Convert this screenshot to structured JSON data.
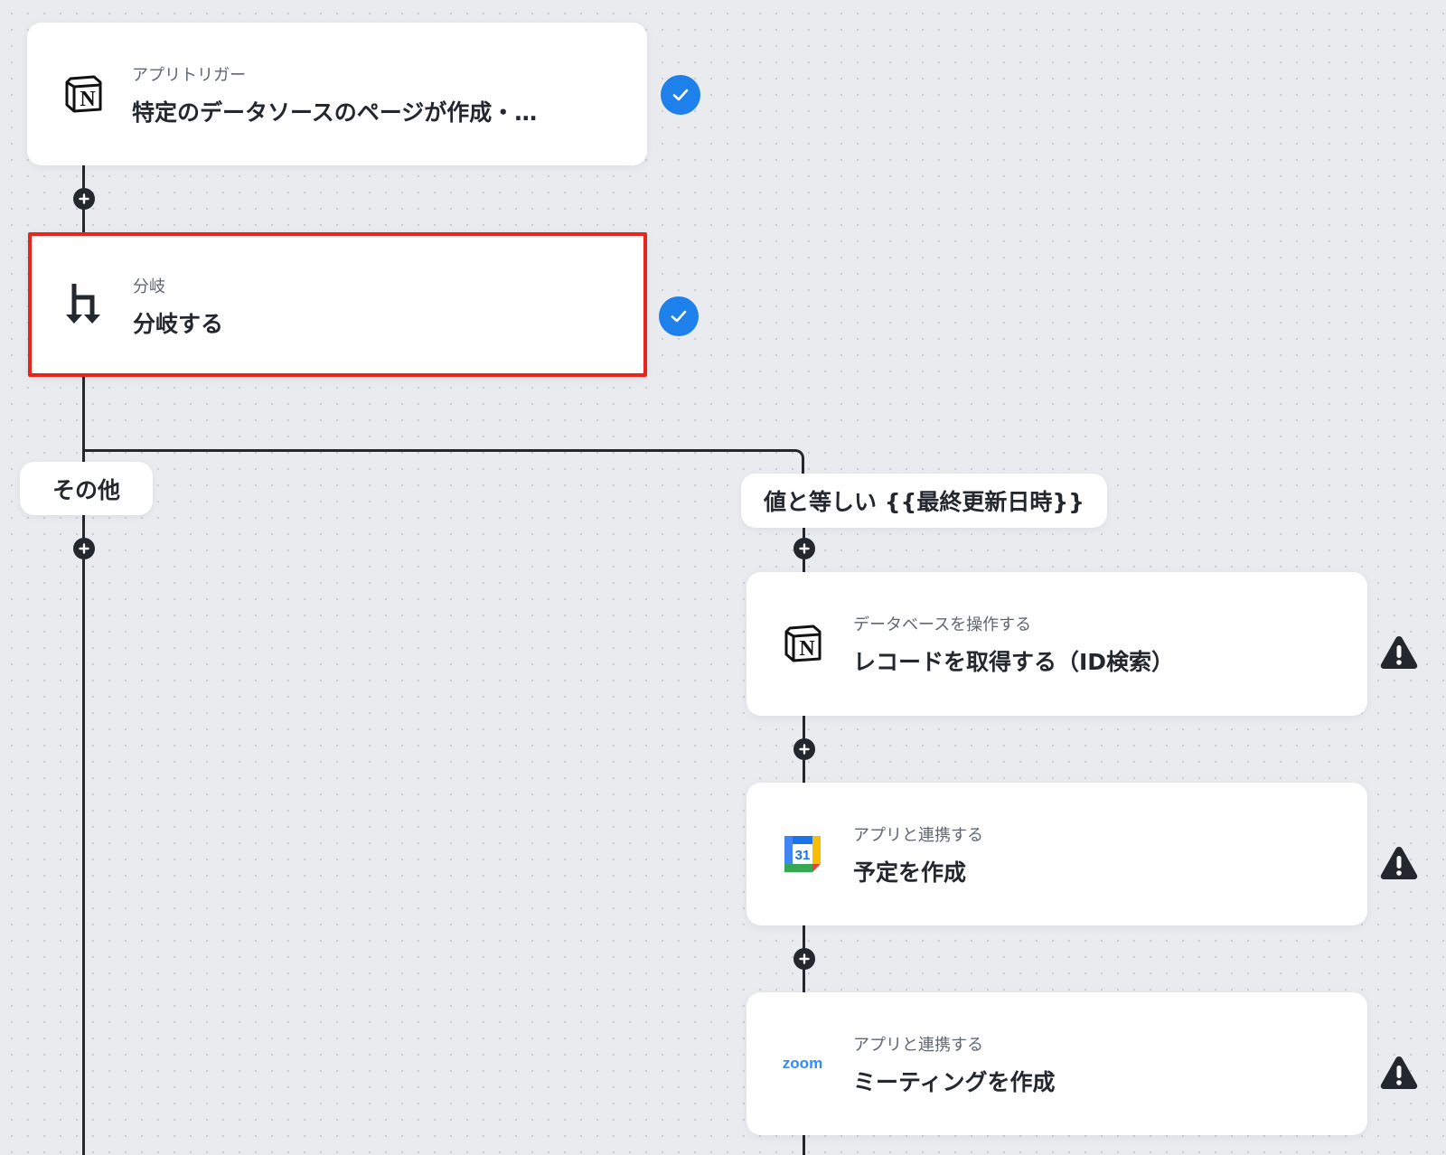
{
  "flow": {
    "trigger": {
      "subtitle": "アプリトリガー",
      "title": "特定のデータソースのページが作成・…",
      "icon": "notion-icon",
      "status": "complete"
    },
    "branch": {
      "subtitle": "分岐",
      "title": "分岐する",
      "icon": "branch-icon",
      "status": "complete",
      "selected": true
    },
    "branches": {
      "other_label": "その他",
      "condition_label": "値と等しい {{最終更新日時}}"
    },
    "steps": [
      {
        "subtitle": "データベースを操作する",
        "title": "レコードを取得する（ID検索）",
        "icon": "notion-icon",
        "status": "warning"
      },
      {
        "subtitle": "アプリと連携する",
        "title": "予定を作成",
        "icon": "google-calendar-icon",
        "icon_text": "31",
        "status": "warning"
      },
      {
        "subtitle": "アプリと連携する",
        "title": "ミーティングを作成",
        "icon": "zoom-icon",
        "icon_text": "zoom",
        "status": "warning"
      }
    ]
  },
  "colors": {
    "check": "#1e80ea",
    "selected_border": "#e8251c",
    "line": "#23272e",
    "zoom": "#2d8cff"
  }
}
